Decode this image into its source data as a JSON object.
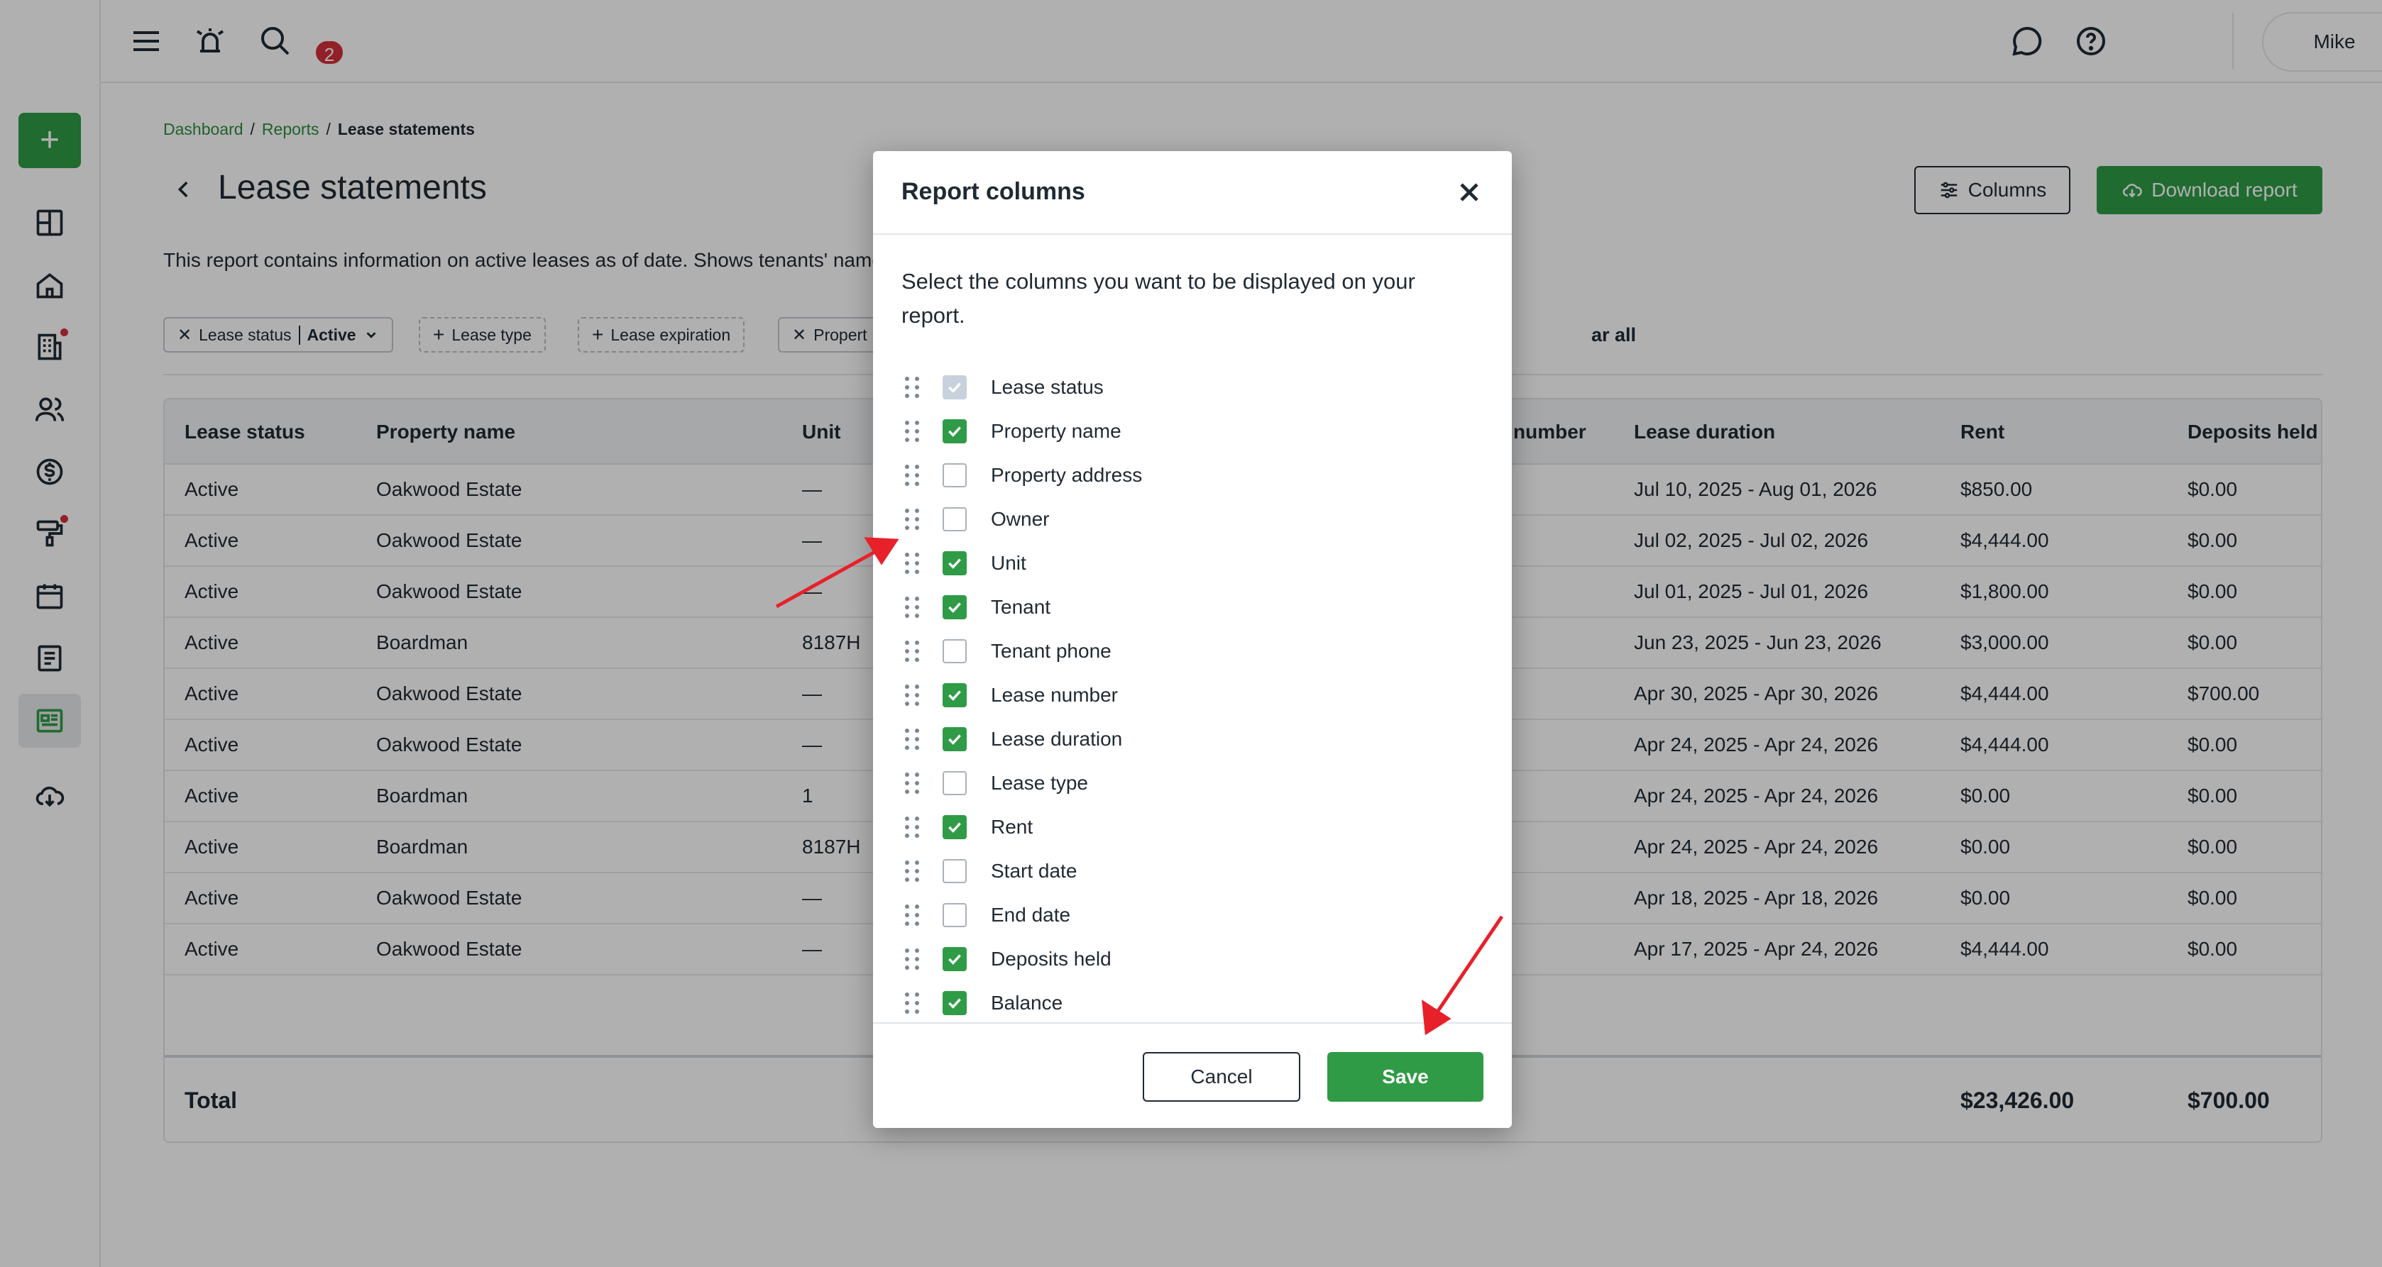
{
  "topbar": {
    "notifications_count": "2",
    "user_name": "Mike"
  },
  "breadcrumb": {
    "items": [
      "Dashboard",
      "Reports"
    ],
    "current": "Lease statements"
  },
  "page": {
    "title": "Lease statements",
    "description": "This report contains information on active leases as of date. Shows tenants' name,",
    "columns_button": "Columns",
    "download_button": "Download report"
  },
  "filters": {
    "lease_status_label": "Lease status",
    "lease_status_value": "Active",
    "lease_type": "Lease type",
    "lease_expiration": "Lease expiration",
    "property": "Propert",
    "clear_all": "ar all"
  },
  "table": {
    "headers": {
      "lease_status": "Lease status",
      "property_name": "Property name",
      "unit": "Unit",
      "lease_number": "number",
      "lease_duration": "Lease duration",
      "rent": "Rent",
      "deposits_held": "Deposits held"
    },
    "rows": [
      {
        "status": "Active",
        "property": "Oakwood Estate",
        "unit": "—",
        "duration": "Jul 10, 2025 - Aug 01, 2026",
        "rent": "$850.00",
        "deposits": "$0.00"
      },
      {
        "status": "Active",
        "property": "Oakwood Estate",
        "unit": "—",
        "duration": "Jul 02, 2025 - Jul 02, 2026",
        "rent": "$4,444.00",
        "deposits": "$0.00"
      },
      {
        "status": "Active",
        "property": "Oakwood Estate",
        "unit": "—",
        "duration": "Jul 01, 2025 - Jul 01, 2026",
        "rent": "$1,800.00",
        "deposits": "$0.00"
      },
      {
        "status": "Active",
        "property": "Boardman",
        "unit": "8187H",
        "duration": "Jun 23, 2025 - Jun 23, 2026",
        "rent": "$3,000.00",
        "deposits": "$0.00"
      },
      {
        "status": "Active",
        "property": "Oakwood Estate",
        "unit": "—",
        "duration": "Apr 30, 2025 - Apr 30, 2026",
        "rent": "$4,444.00",
        "deposits": "$700.00"
      },
      {
        "status": "Active",
        "property": "Oakwood Estate",
        "unit": "—",
        "duration": "Apr 24, 2025 - Apr 24, 2026",
        "rent": "$4,444.00",
        "deposits": "$0.00"
      },
      {
        "status": "Active",
        "property": "Boardman",
        "unit": "1",
        "duration": "Apr 24, 2025 - Apr 24, 2026",
        "rent": "$0.00",
        "deposits": "$0.00"
      },
      {
        "status": "Active",
        "property": "Boardman",
        "unit": "8187H",
        "duration": "Apr 24, 2025 - Apr 24, 2026",
        "rent": "$0.00",
        "deposits": "$0.00"
      },
      {
        "status": "Active",
        "property": "Oakwood Estate",
        "unit": "—",
        "duration": "Apr 18, 2025 - Apr 18, 2026",
        "rent": "$0.00",
        "deposits": "$0.00"
      },
      {
        "status": "Active",
        "property": "Oakwood Estate",
        "unit": "—",
        "duration": "Apr 17, 2025 - Apr 24, 2026",
        "rent": "$4,444.00",
        "deposits": "$0.00"
      }
    ],
    "total": {
      "label": "Total",
      "rent": "$23,426.00",
      "deposits": "$700.00"
    }
  },
  "modal": {
    "title": "Report columns",
    "description": "Select the columns you want to be displayed on your report.",
    "options": [
      {
        "label": "Lease status",
        "state": "disabled"
      },
      {
        "label": "Property name",
        "state": "checked"
      },
      {
        "label": "Property address",
        "state": "unchecked"
      },
      {
        "label": "Owner",
        "state": "unchecked"
      },
      {
        "label": "Unit",
        "state": "checked"
      },
      {
        "label": "Tenant",
        "state": "checked"
      },
      {
        "label": "Tenant phone",
        "state": "unchecked"
      },
      {
        "label": "Lease number",
        "state": "checked"
      },
      {
        "label": "Lease duration",
        "state": "checked"
      },
      {
        "label": "Lease type",
        "state": "unchecked"
      },
      {
        "label": "Rent",
        "state": "checked"
      },
      {
        "label": "Start date",
        "state": "unchecked"
      },
      {
        "label": "End date",
        "state": "unchecked"
      },
      {
        "label": "Deposits held",
        "state": "checked"
      },
      {
        "label": "Balance",
        "state": "checked"
      }
    ],
    "cancel": "Cancel",
    "save": "Save"
  },
  "colors": {
    "accent": "#2f9b46",
    "badge": "#d32f3c",
    "annotation_arrow": "#e8202a"
  }
}
